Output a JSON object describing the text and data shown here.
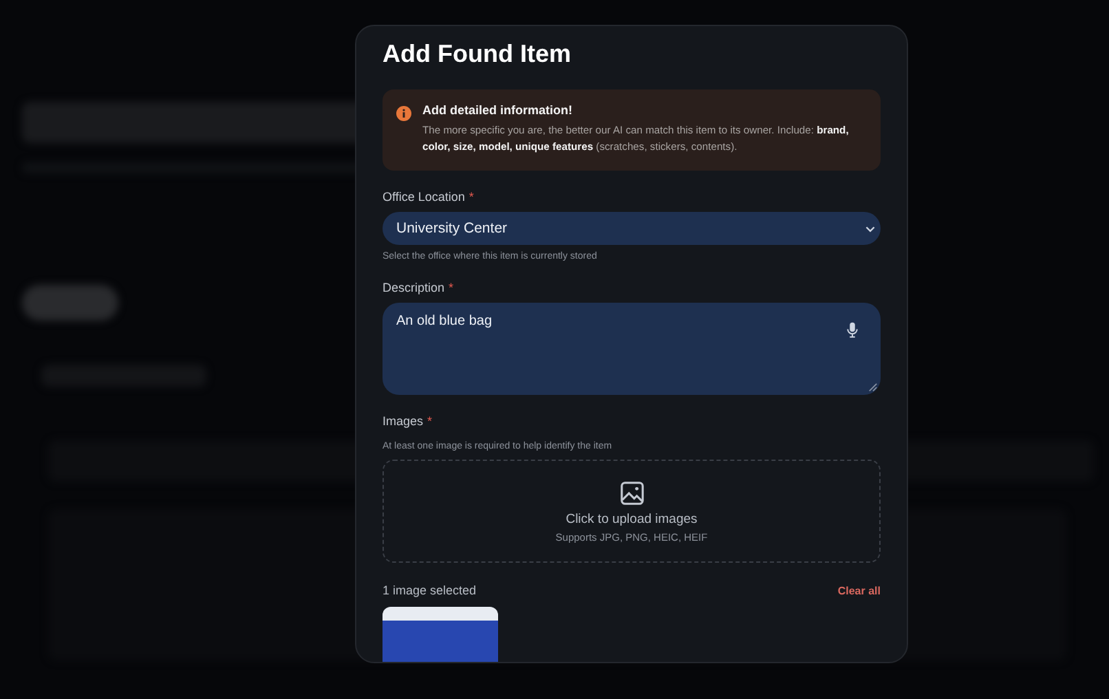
{
  "modal": {
    "title": "Add Found Item",
    "notice": {
      "title": "Add detailed information!",
      "text": "The more specific you are, the better our AI can match this item to its owner. Include: **brand, color, size, model, unique features** (scratches, stickers, contents)."
    },
    "fields": [
      {
        "kind": "select",
        "label": "Office Location",
        "required_mark": "*",
        "value": "University Center",
        "hint": "Select the office where this item is currently stored"
      },
      {
        "kind": "textarea",
        "label": "Description",
        "required_mark": "*",
        "value": "An old blue bag"
      },
      {
        "kind": "upload",
        "label": "Images",
        "required_mark": "*",
        "hint": "At least one image is required to help identify the item",
        "prompt": "Click to upload images",
        "formats": "Supports JPG, PNG, HEIC, HEIF"
      }
    ],
    "selection": {
      "count_text": "1 image selected",
      "clear": "Clear all"
    }
  }
}
